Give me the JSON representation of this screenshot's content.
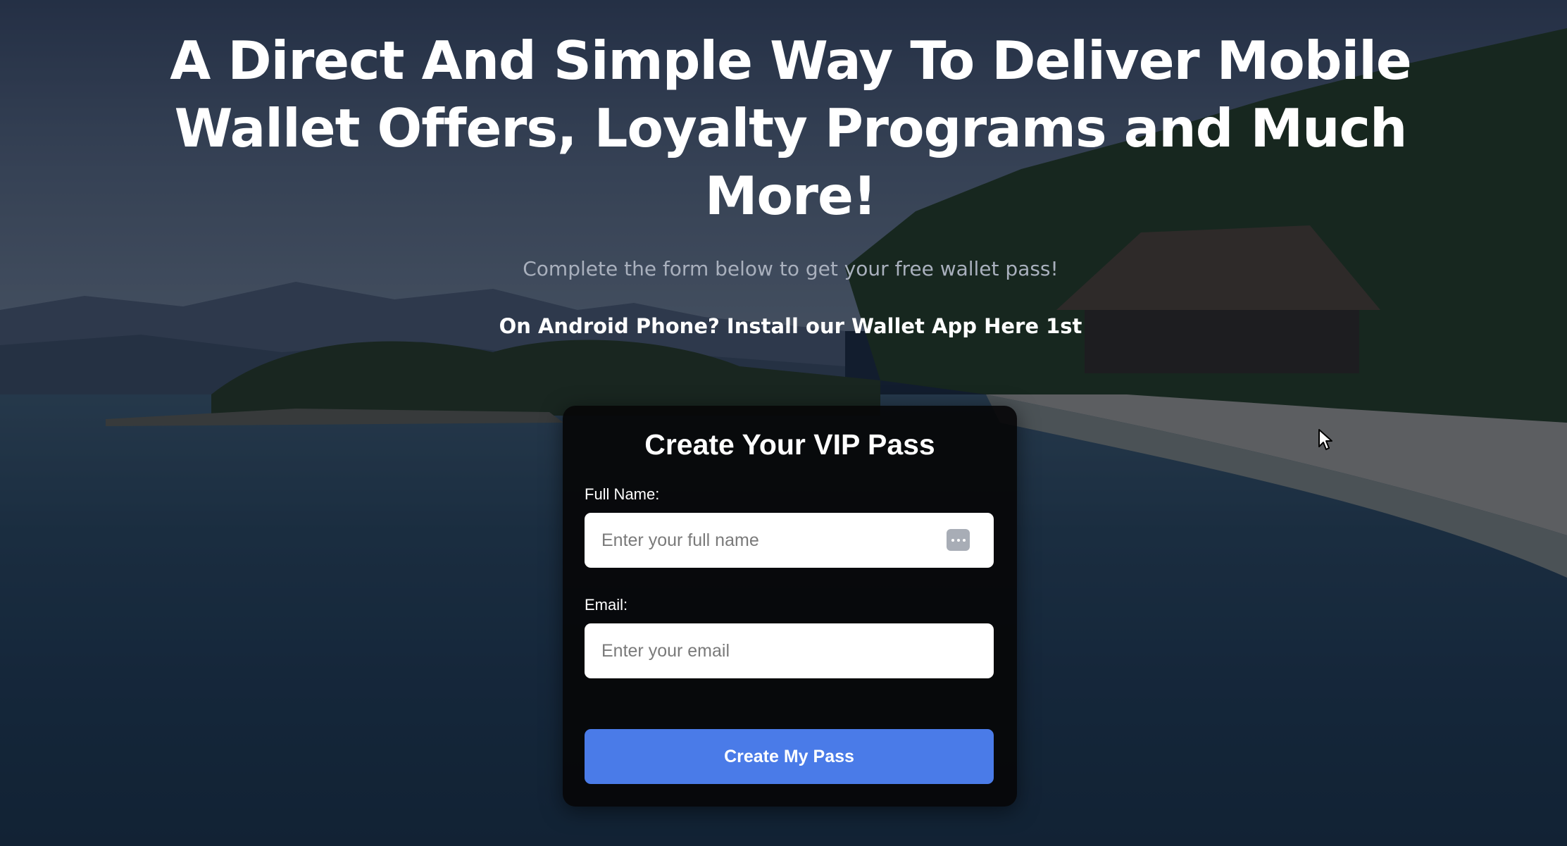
{
  "hero": {
    "title": "A Direct And Simple Way To Deliver Mobile Wallet Offers, Loyalty Programs and Much More!",
    "subtitle": "Complete the form below to get your free wallet pass!",
    "android_link": "On Android Phone? Install our Wallet App Here 1st"
  },
  "form": {
    "title": "Create Your VIP Pass",
    "full_name": {
      "label": "Full Name:",
      "placeholder": "Enter your full name",
      "value": ""
    },
    "email": {
      "label": "Email:",
      "placeholder": "Enter your email",
      "value": ""
    },
    "submit_label": "Create My Pass"
  },
  "icons": {
    "autofill": "autofill-dots-icon",
    "cursor": "mouse-pointer-icon"
  },
  "colors": {
    "button": "#4a7be8",
    "card_background": "#060608",
    "title_text": "#ffffff",
    "subtitle_text": "#a9b0bd"
  }
}
